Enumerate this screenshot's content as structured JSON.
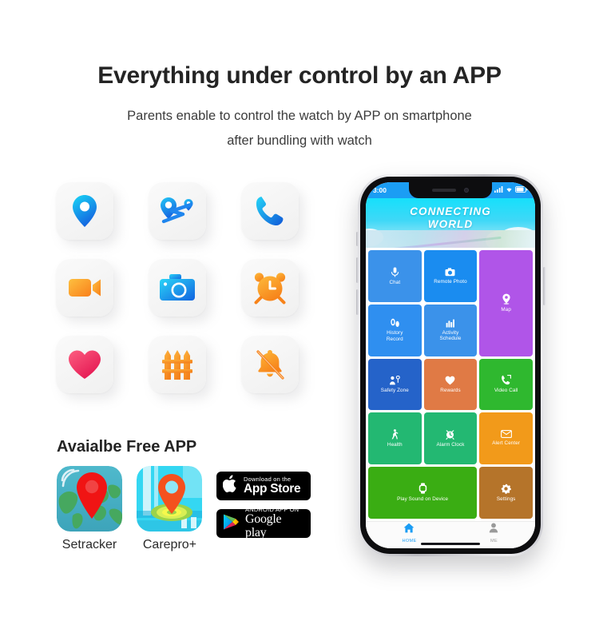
{
  "headline": "Everything under control by an APP",
  "subtitle_line1": "Parents enable to control the watch by APP on smartphone",
  "subtitle_line2": "after bundling with watch",
  "features": [
    {
      "name": "location-pin-icon",
      "label": "Location"
    },
    {
      "name": "route-path-icon",
      "label": "Route Tracking"
    },
    {
      "name": "phone-call-icon",
      "label": "Phone Call"
    },
    {
      "name": "video-camera-icon",
      "label": "Video Call"
    },
    {
      "name": "camera-icon",
      "label": "Remote Camera"
    },
    {
      "name": "alarm-clock-icon",
      "label": "Alarm Clock"
    },
    {
      "name": "heart-icon",
      "label": "Health"
    },
    {
      "name": "fence-icon",
      "label": "Safety Zone"
    },
    {
      "name": "bell-off-icon",
      "label": "Silent Mode"
    }
  ],
  "available_app": {
    "title": "Avaialbe Free APP",
    "apps": [
      {
        "name": "setracker",
        "label": "Setracker"
      },
      {
        "name": "carepro",
        "label": "Carepro+"
      }
    ]
  },
  "badges": [
    {
      "name": "app-store-badge",
      "small": "Download on the",
      "big": "App Store",
      "glyph": "apple-icon"
    },
    {
      "name": "google-play-badge",
      "small": "ANDROID APP ON",
      "big": "Google play",
      "glyph": "play-triangle-icon"
    }
  ],
  "phone": {
    "status_bar": {
      "time": "3:00",
      "icons": [
        "signal-bars-icon",
        "wifi-icon",
        "battery-icon"
      ]
    },
    "hero": {
      "title_line1": "CONNECTING",
      "title_line2": "WORLD"
    },
    "tiles": [
      {
        "name": "tile-chat",
        "label": "Chat",
        "icon": "microphone-icon",
        "color": "#3b92ea"
      },
      {
        "name": "tile-remote-photo",
        "label": "Remote Photo",
        "icon": "camera-icon",
        "color": "#1a8cf0"
      },
      {
        "name": "tile-map",
        "label": "Map",
        "icon": "map-pin-icon",
        "color": "#b055e8"
      },
      {
        "name": "tile-history-record",
        "label": "History\nRecord",
        "icon": "footprints-icon",
        "color": "#2f8ff0"
      },
      {
        "name": "tile-activity-schedule",
        "label": "Activity\nSchedule",
        "icon": "bar-chart-icon",
        "color": "#3b92ea"
      },
      {
        "name": "tile-safety-zone",
        "label": "Safety Zone",
        "icon": "safety-zone-icon",
        "color": "#2563c9"
      },
      {
        "name": "tile-rewards",
        "label": "Rewards",
        "icon": "heart-icon",
        "color": "#e07a45"
      },
      {
        "name": "tile-video-call",
        "label": "Video Call",
        "icon": "phone-video-icon",
        "color": "#2fb82f"
      },
      {
        "name": "tile-health",
        "label": "Health",
        "icon": "walking-icon",
        "color": "#23b872"
      },
      {
        "name": "tile-alarm-clock",
        "label": "Alarm Clock",
        "icon": "alarm-clock-icon",
        "color": "#23b872"
      },
      {
        "name": "tile-alert-center",
        "label": "Alert Center",
        "icon": "envelope-icon",
        "color": "#f29a1a"
      },
      {
        "name": "tile-play-sound",
        "label": "Play Sound on Device",
        "icon": "watch-icon",
        "color": "#3aad13"
      },
      {
        "name": "tile-settings",
        "label": "Settings",
        "icon": "gear-icon",
        "color": "#b5742a"
      }
    ],
    "tabbar": [
      {
        "name": "tab-home",
        "label": "HOME",
        "icon": "home-icon",
        "active": true
      },
      {
        "name": "tab-me",
        "label": "ME",
        "icon": "person-icon",
        "active": false
      }
    ]
  },
  "colors": {
    "status_bar": "#1b9df4",
    "accent": "#1b9df4",
    "heading": "#242424"
  }
}
